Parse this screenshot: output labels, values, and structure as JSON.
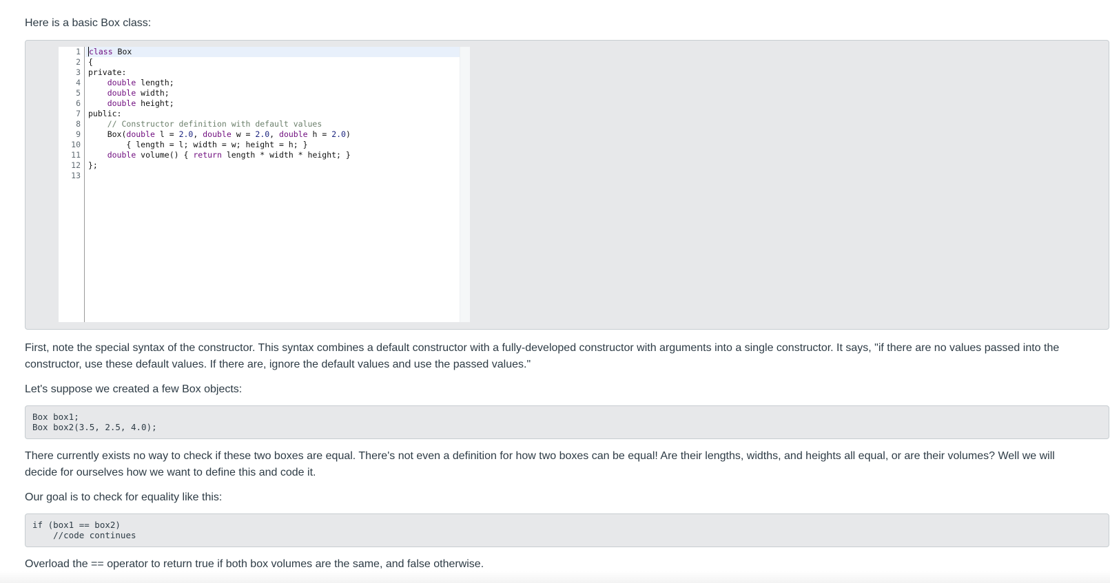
{
  "intro": "Here is a basic Box class:",
  "editor": {
    "line_numbers": [
      "1",
      "2",
      "3",
      "4",
      "5",
      "6",
      "7",
      "8",
      "9",
      "10",
      "11",
      "12",
      "13"
    ]
  },
  "paragraphs": {
    "p1": "First, note the special syntax of the constructor. This syntax combines a default constructor with a fully-developed constructor with arguments into a single constructor. It says, \"if there are no values passed into the constructor, use these default values. If there are, ignore the default values and use the passed values.\"",
    "p2": "Let's suppose we created a few Box objects:",
    "p3": "There currently exists no way to check if these two boxes are equal. There's not even a definition for how two boxes can be equal! Are their lengths, widths, and heights all equal, or are their volumes? Well we will decide for ourselves how we want to define this and code it.",
    "p4": "Our goal is to check for equality like this:",
    "p5": "Overload the == operator to return true if both box volumes are the same, and false otherwise."
  },
  "code_blocks": {
    "objects": "Box box1;\nBox box2(3.5, 2.5, 4.0);",
    "equality": "if (box1 == box2)\n    //code continues"
  },
  "code": {
    "l1_kw": "class",
    "l1_rest": " Box",
    "l2": "{",
    "l3": "private:",
    "l4_kw": "double",
    "l4_rest": " length;",
    "l5_kw": "double",
    "l5_rest": " width;",
    "l6_kw": "double",
    "l6_rest": " height;",
    "l7": "public:",
    "l8": "// Constructor definition with default values",
    "l9_a": "Box(",
    "l9_kw1": "double",
    "l9_b": " l = ",
    "l9_n1": "2.0",
    "l9_c": ", ",
    "l9_kw2": "double",
    "l9_d": " w = ",
    "l9_n2": "2.0",
    "l9_e": ", ",
    "l9_kw3": "double",
    "l9_f": " h = ",
    "l9_n3": "2.0",
    "l9_g": ")",
    "l10": "{ length = l; width = w; height = h; }",
    "l11_kw1": "double",
    "l11_a": " volume() { ",
    "l11_kw2": "return",
    "l11_b": " length * width * height; }",
    "l12": "};"
  }
}
